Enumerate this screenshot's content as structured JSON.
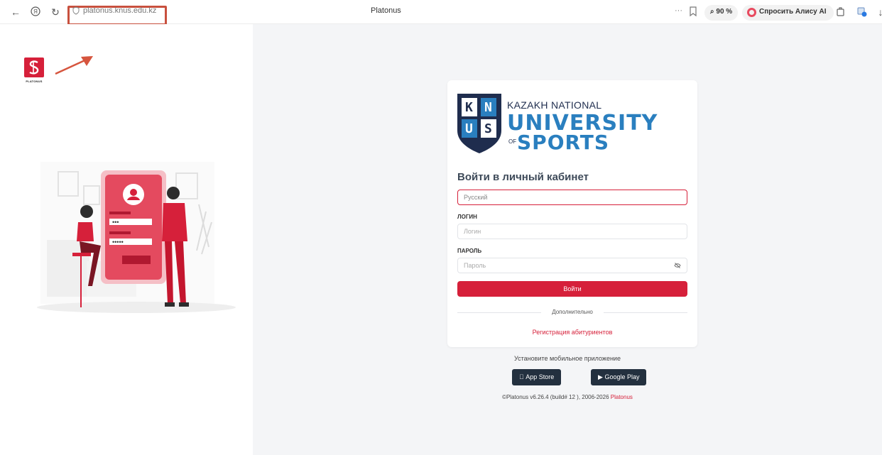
{
  "browser": {
    "url": "platonus.knus.edu.kz",
    "tab_title": "Platonus",
    "zoom": "90 %",
    "alice_label": "Спросить Алису AI",
    "menu_dots": "···"
  },
  "brand": {
    "logo_text": "PLATONUS",
    "accent_color": "#d6203a"
  },
  "university": {
    "line1": "KAZAKH NATIONAL",
    "line2": "UNIVERSITY",
    "line3_prefix": "OF",
    "line3": "SPORTS",
    "letters": [
      "K",
      "N",
      "U",
      "S"
    ]
  },
  "form": {
    "title": "Войти в личный кабинет",
    "language_value": "Русский",
    "login_label": "ЛОГИН",
    "login_placeholder": "Логин",
    "password_label": "ПАРОЛЬ",
    "password_placeholder": "Пароль",
    "submit_label": "Войти",
    "divider_text": "Дополнительно",
    "registration_link": "Регистрация абитуриентов"
  },
  "footer": {
    "mobile_prompt": "Установите мобильное приложение",
    "app_store": "App Store",
    "google_play": "Google Play",
    "copyright": "©Platonus v6.26.4 (build# 12 ), 2006-2026",
    "copyright_brand": "Platonus"
  }
}
